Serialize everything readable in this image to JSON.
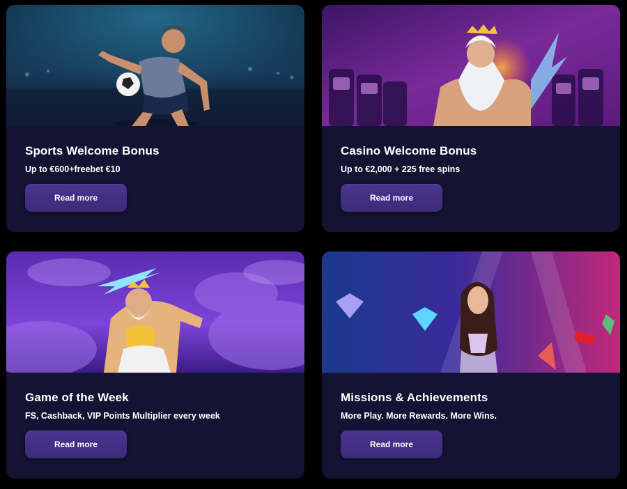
{
  "colors": {
    "page_background": "#000000",
    "card_background": "#141333",
    "button_background": "#43318a",
    "text": "#ffffff"
  },
  "promotions": [
    {
      "title": "Sports Welcome Bonus",
      "subtitle": "Up to €600+freebet €10",
      "button_label": "Read more",
      "banner": "soccer-player-kicking-ball-image"
    },
    {
      "title": "Casino Welcome Bonus",
      "subtitle": "Up to €2,000 + 225 free spins",
      "button_label": "Read more",
      "banner": "zeus-casino-image"
    },
    {
      "title": "Game of the Week",
      "subtitle": "FS, Cashback, VIP Points Multiplier every week",
      "button_label": "Read more",
      "banner": "zeus-lightning-clouds-image"
    },
    {
      "title": "Missions & Achievements",
      "subtitle": "More Play. More Rewards. More Wins.",
      "button_label": "Read more",
      "banner": "woman-holding-diamond-image"
    }
  ]
}
